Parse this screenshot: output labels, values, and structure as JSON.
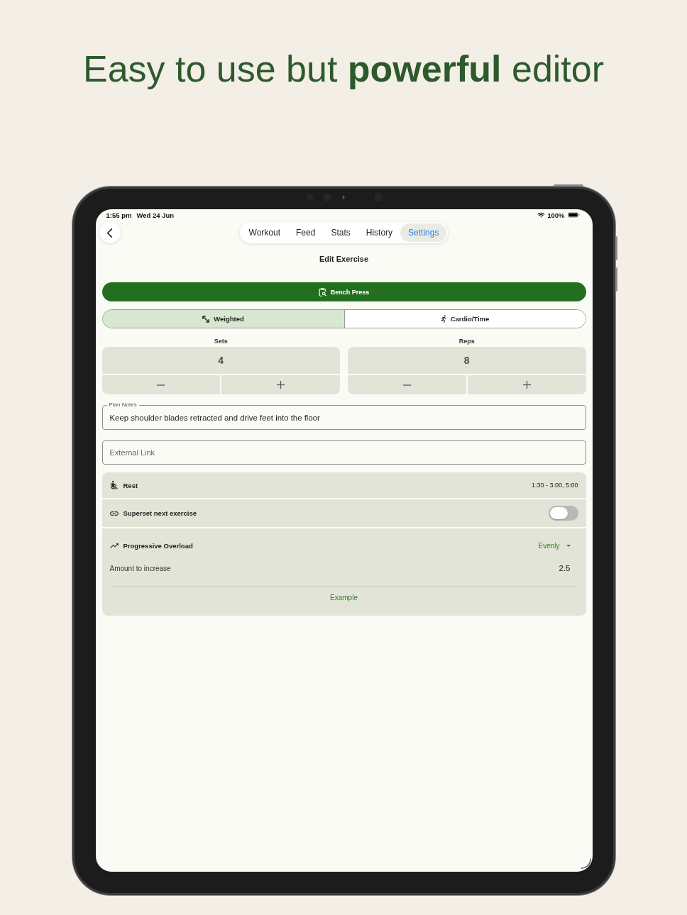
{
  "headline": "Easy to use but **powerful** editor",
  "status_bar": {
    "time": "1:55 pm",
    "date": "Wed 24 Jun",
    "battery": "100%"
  },
  "nav": {
    "tabs": [
      {
        "label": "Workout",
        "selected": false
      },
      {
        "label": "Feed",
        "selected": false
      },
      {
        "label": "Stats",
        "selected": false
      },
      {
        "label": "History",
        "selected": false
      },
      {
        "label": "Settings",
        "selected": true
      }
    ]
  },
  "title": "Edit Exercise",
  "exercise_button": {
    "label": "Bench Press"
  },
  "exercise_types": [
    {
      "kind": "weighted",
      "label": "Weighted",
      "selected": true
    },
    {
      "kind": "cardio",
      "label": "Cardio/Time",
      "selected": false
    }
  ],
  "steppers": [
    {
      "label": "Sets",
      "value": "4"
    },
    {
      "label": "Reps",
      "value": "8"
    }
  ],
  "notes_field": {
    "label": "Plan Notes",
    "value": "Keep shoulder blades retracted and drive feet into the floor"
  },
  "link_field": {
    "placeholder": "External Link"
  },
  "settings_rows": [
    {
      "kind": "rest",
      "label": "Rest",
      "value": "1:30 - 3:00, 5:00"
    },
    {
      "kind": "superset",
      "label": "Superset next exercise",
      "on": false
    }
  ],
  "progressive_overload": {
    "label": "Progressive Overload",
    "mode": "Evenly",
    "amount_label": "Amount to increase",
    "amount": "2.5",
    "example_link": "Example"
  }
}
